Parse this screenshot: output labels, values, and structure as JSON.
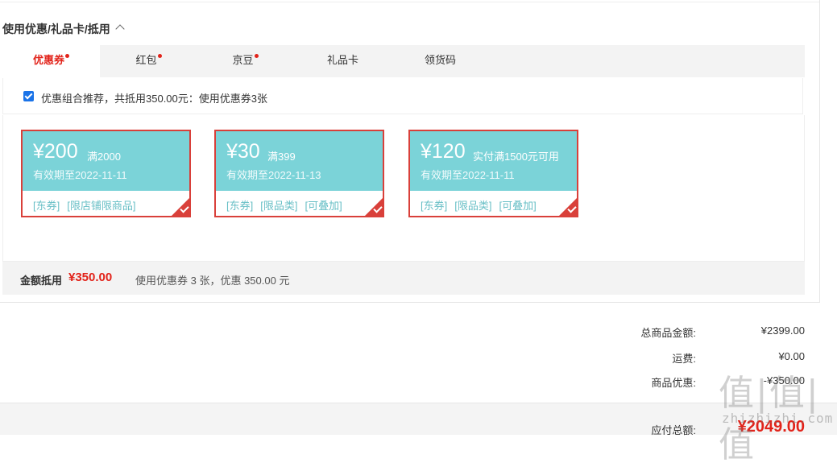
{
  "section": {
    "title": "使用优惠/礼品卡/抵用"
  },
  "tabs": [
    {
      "label": "优惠券",
      "dot": true,
      "active": true
    },
    {
      "label": "红包",
      "dot": true,
      "active": false
    },
    {
      "label": "京豆",
      "dot": true,
      "active": false
    },
    {
      "label": "礼品卡",
      "dot": false,
      "active": false
    },
    {
      "label": "领货码",
      "dot": false,
      "active": false
    }
  ],
  "combo": {
    "checked": true,
    "text": "优惠组合推荐，共抵用350.00元：使用优惠券3张"
  },
  "coupons": [
    {
      "amount": "¥200",
      "condition": "满2000",
      "validity": "有效期至2022-11-11",
      "tags": [
        "[东券]",
        "[限店铺限商品]"
      ],
      "selected": true
    },
    {
      "amount": "¥30",
      "condition": "满399",
      "validity": "有效期至2022-11-13",
      "tags": [
        "[东券]",
        "[限品类]",
        "[可叠加]"
      ],
      "selected": true
    },
    {
      "amount": "¥120",
      "condition": "实付满1500元可用",
      "validity": "有效期至2022-11-11",
      "tags": [
        "[东券]",
        "[限品类]",
        "[可叠加]"
      ],
      "selected": true
    }
  ],
  "summary": {
    "label": "金额抵用",
    "amount": "¥350.00",
    "desc": "使用优惠券 3 张，优惠 350.00 元"
  },
  "totals": [
    {
      "label": "总商品金额:",
      "value": "¥2399.00"
    },
    {
      "label": "运费:",
      "value": "¥0.00"
    },
    {
      "label": "商品优惠:",
      "value": "-¥350.00"
    }
  ],
  "payable": {
    "label": "应付总额:",
    "value": "¥2049.00"
  },
  "watermark": {
    "main": "值|值|值",
    "sub": "zhizhizhi.com"
  },
  "colors": {
    "accent": "#e2231a",
    "coupon_bg": "#7bd3d8",
    "coupon_border": "#d9403a",
    "tag": "#68bfc6"
  }
}
